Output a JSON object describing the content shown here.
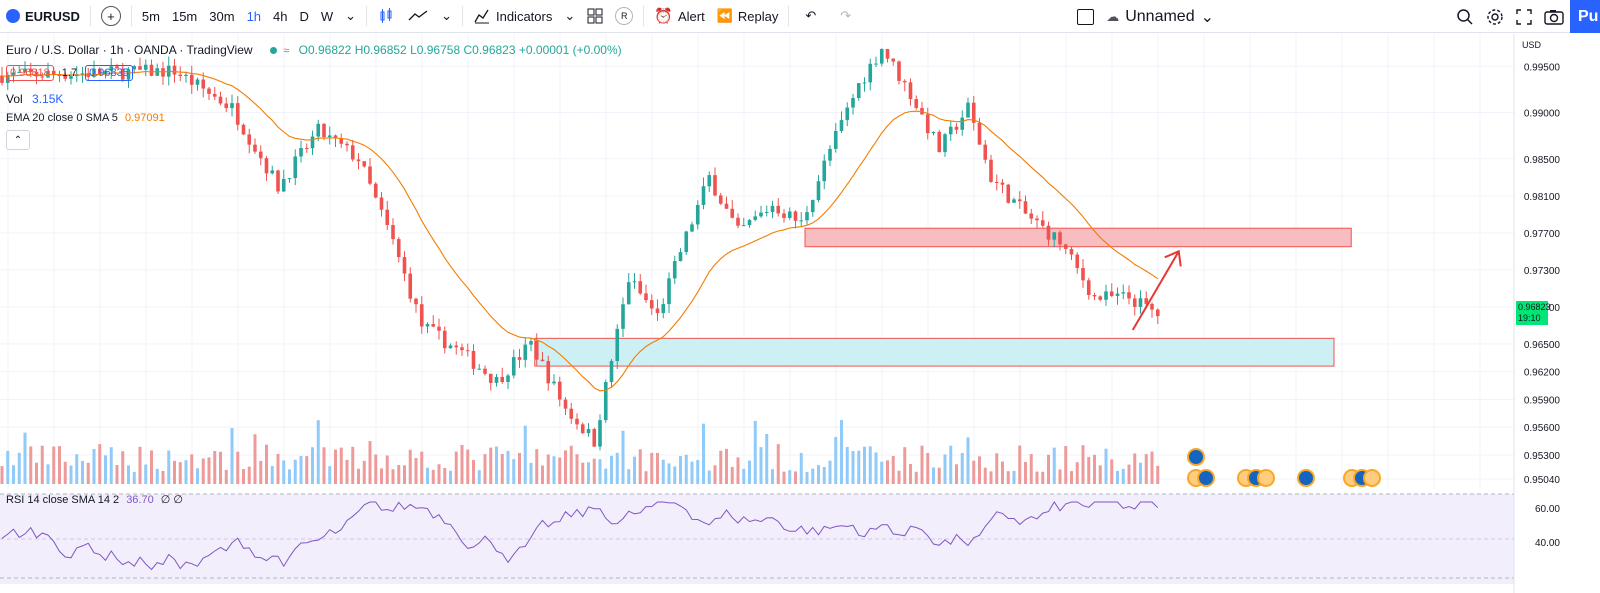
{
  "toolbar": {
    "symbol": "EURUSD",
    "timeframes": [
      "5m",
      "15m",
      "30m",
      "1h",
      "4h",
      "D",
      "W"
    ],
    "active_timeframe": "1h",
    "indicators_label": "Indicators",
    "r_label": "R",
    "alert_label": "Alert",
    "replay_label": "Replay",
    "layout_name": "Unnamed",
    "publish_label": "Pu"
  },
  "legend": {
    "title": "Euro / U.S. Dollar · 1h · OANDA · TradingView",
    "open": "O0.96822",
    "high": "H0.96852",
    "low": "L0.96758",
    "close": "C0.96823",
    "change": "+0.00001 (+0.00%)",
    "bid": "0.96818",
    "spread": "1.7",
    "ask": "0.96835",
    "vol_label": "Vol",
    "vol_value": "3.15K",
    "ema_label": "EMA 20 close 0 SMA 5",
    "ema_value": "0.97091",
    "rsi_label": "RSI 14 close SMA 14 2",
    "rsi_value": "36.70",
    "rsi_extra": "∅ ∅"
  },
  "price_axis": {
    "currency": "USD",
    "labels": [
      "0.99500",
      "0.99000",
      "0.98500",
      "0.98100",
      "0.97700",
      "0.97300",
      "0.96900",
      "0.96500",
      "0.96200",
      "0.95900",
      "0.95600",
      "0.95300",
      "0.95040"
    ],
    "current_price": "0.96823",
    "countdown": "19:10"
  },
  "rsi_axis": {
    "labels": [
      "60.00",
      "40.00"
    ]
  },
  "colors": {
    "up": "#26a69a",
    "down": "#ef5350",
    "ema": "#f57c00",
    "rsi": "#7e57c2",
    "resistance_zone": "#f7b6b9",
    "support_zone": "#c7eef2",
    "arrow": "#e53935"
  },
  "chart_data": {
    "type": "candlestick",
    "symbol": "EURUSD",
    "interval": "1h",
    "ylim": [
      0.9504,
      0.996
    ],
    "close_path": [
      {
        "bar": 0,
        "price": 0.994
      },
      {
        "bar": 30,
        "price": 0.9945
      },
      {
        "bar": 40,
        "price": 0.9905
      },
      {
        "bar": 48,
        "price": 0.982
      },
      {
        "bar": 55,
        "price": 0.988
      },
      {
        "bar": 62,
        "price": 0.985
      },
      {
        "bar": 68,
        "price": 0.976
      },
      {
        "bar": 73,
        "price": 0.967
      },
      {
        "bar": 80,
        "price": 0.964
      },
      {
        "bar": 86,
        "price": 0.961
      },
      {
        "bar": 92,
        "price": 0.965
      },
      {
        "bar": 98,
        "price": 0.958
      },
      {
        "bar": 103,
        "price": 0.9545
      },
      {
        "bar": 109,
        "price": 0.972
      },
      {
        "bar": 114,
        "price": 0.968
      },
      {
        "bar": 118,
        "price": 0.975
      },
      {
        "bar": 123,
        "price": 0.983
      },
      {
        "bar": 128,
        "price": 0.977
      },
      {
        "bar": 134,
        "price": 0.98
      },
      {
        "bar": 139,
        "price": 0.978
      },
      {
        "bar": 144,
        "price": 0.986
      },
      {
        "bar": 149,
        "price": 0.993
      },
      {
        "bar": 153,
        "price": 0.997
      },
      {
        "bar": 158,
        "price": 0.992
      },
      {
        "bar": 163,
        "price": 0.986
      },
      {
        "bar": 168,
        "price": 0.9905
      },
      {
        "bar": 172,
        "price": 0.983
      },
      {
        "bar": 178,
        "price": 0.979
      },
      {
        "bar": 184,
        "price": 0.976
      },
      {
        "bar": 190,
        "price": 0.97
      },
      {
        "bar": 196,
        "price": 0.97
      },
      {
        "bar": 201,
        "price": 0.9682
      }
    ],
    "zones": [
      {
        "name": "resistance",
        "from_bar": 140,
        "to_bar": 235,
        "low": 0.9755,
        "high": 0.9775
      },
      {
        "name": "support",
        "from_bar": 93,
        "to_bar": 232,
        "low": 0.9626,
        "high": 0.9656
      }
    ],
    "annotation": {
      "type": "arrow",
      "from": {
        "bar": 197,
        "price": 0.9665
      },
      "to": {
        "bar": 205,
        "price": 0.975
      }
    }
  }
}
